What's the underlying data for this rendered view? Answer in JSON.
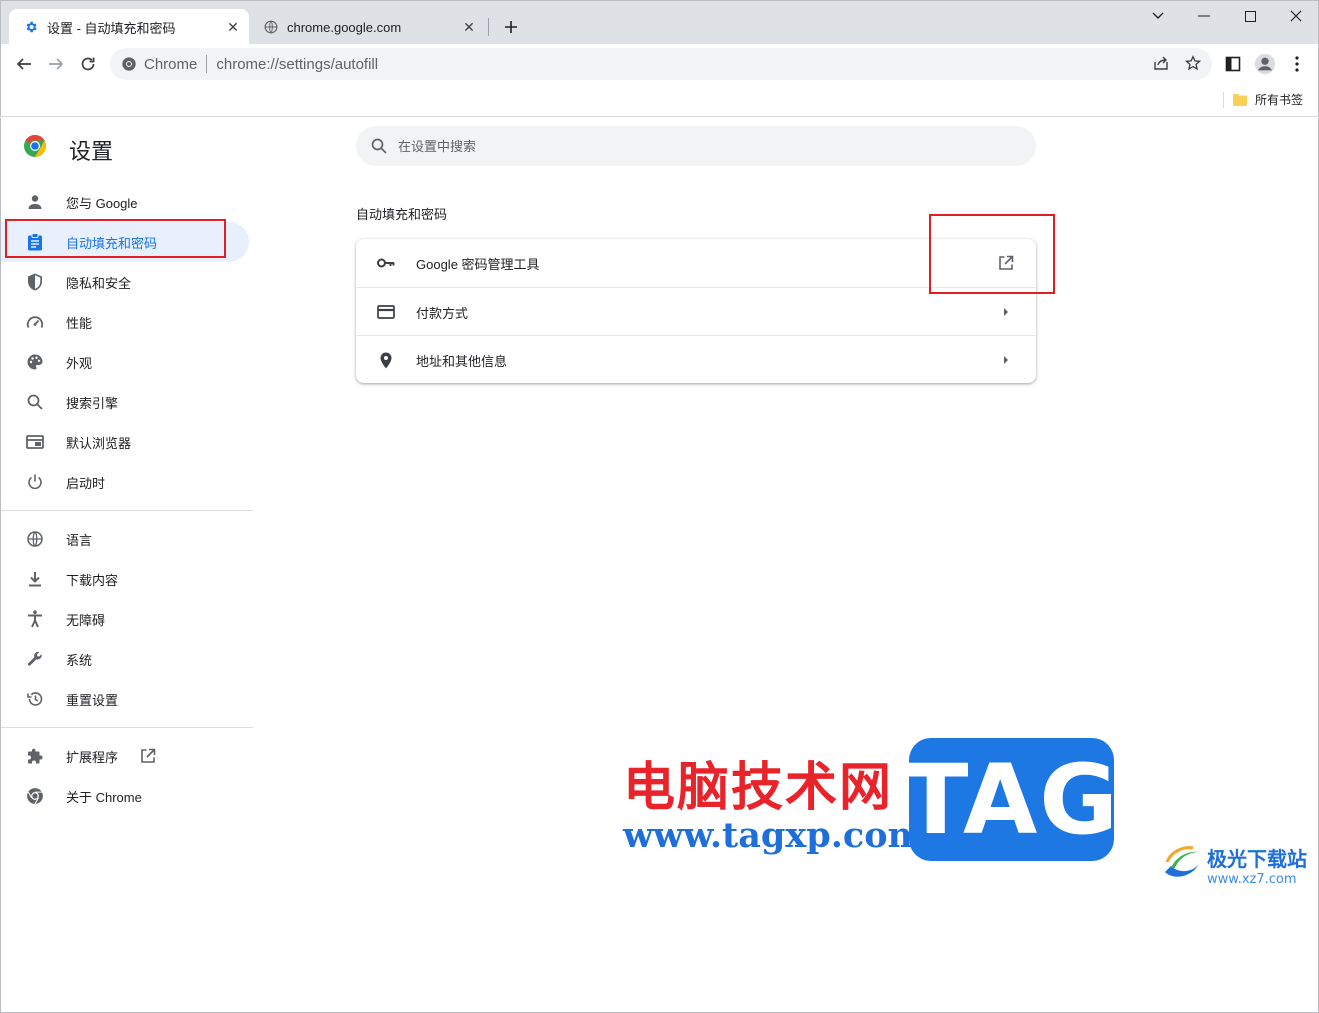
{
  "tabs": [
    {
      "title": "设置 - 自动填充和密码",
      "icon": "gear-icon",
      "active": true
    },
    {
      "title": "chrome.google.com",
      "icon": "globe-icon",
      "active": false
    }
  ],
  "omnibox": {
    "chip": "Chrome",
    "url": "chrome://settings/autofill"
  },
  "bookmarks": {
    "all_label": "所有书签"
  },
  "settings": {
    "title": "设置",
    "search_placeholder": "在设置中搜索"
  },
  "nav": {
    "group1": [
      {
        "label": "您与 Google",
        "icon": "person-icon"
      },
      {
        "label": "自动填充和密码",
        "icon": "clipboard-icon",
        "selected": true
      },
      {
        "label": "隐私和安全",
        "icon": "shield-icon"
      },
      {
        "label": "性能",
        "icon": "speedometer-icon"
      },
      {
        "label": "外观",
        "icon": "palette-icon"
      },
      {
        "label": "搜索引擎",
        "icon": "search-icon"
      },
      {
        "label": "默认浏览器",
        "icon": "browser-window-icon"
      },
      {
        "label": "启动时",
        "icon": "power-icon"
      }
    ],
    "group2": [
      {
        "label": "语言",
        "icon": "globe-icon"
      },
      {
        "label": "下载内容",
        "icon": "download-icon"
      },
      {
        "label": "无障碍",
        "icon": "accessibility-icon"
      },
      {
        "label": "系统",
        "icon": "wrench-icon"
      },
      {
        "label": "重置设置",
        "icon": "history-icon"
      }
    ],
    "group3": [
      {
        "label": "扩展程序",
        "icon": "puzzle-icon"
      },
      {
        "label": "关于 Chrome",
        "icon": "chrome-icon"
      }
    ]
  },
  "main": {
    "section_title": "自动填充和密码",
    "rows": [
      {
        "label": "Google 密码管理工具",
        "icon": "key-icon",
        "trailing": "open-in-new-icon"
      },
      {
        "label": "付款方式",
        "icon": "credit-card-icon",
        "trailing": "arrow-right-icon"
      },
      {
        "label": "地址和其他信息",
        "icon": "location-pin-icon",
        "trailing": "arrow-right-icon"
      }
    ]
  },
  "watermark": {
    "cn_text": "电脑技术网",
    "url": "www.tagxp.com",
    "tag": "TAG",
    "site_cn": "极光下载站",
    "site_url": "www.xz7.com"
  },
  "colors": {
    "accent": "#1a73e8",
    "selected_bg": "#e8f0fe",
    "annotation": "#e02020"
  }
}
